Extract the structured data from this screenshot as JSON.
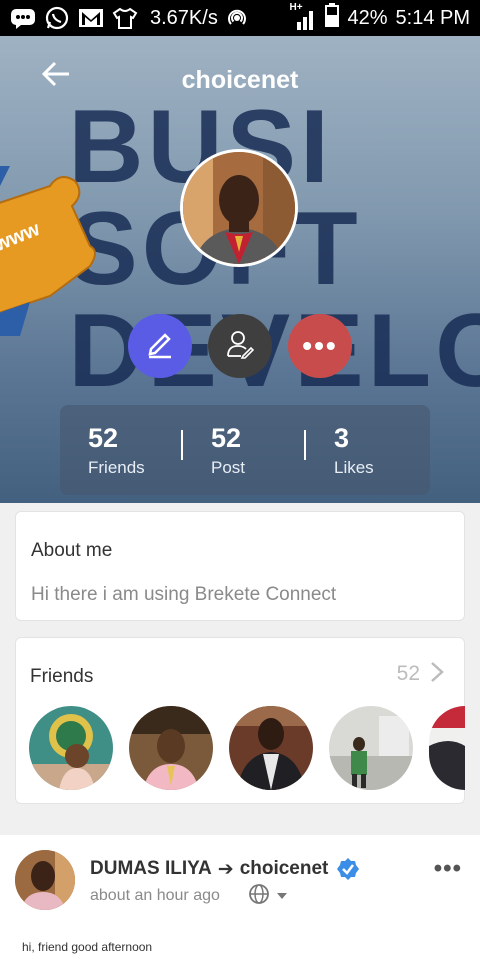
{
  "status_bar": {
    "speed": "3.67K/s",
    "network_label": "H+",
    "battery": "42%",
    "time": "5:14 PM",
    "icons": [
      "chat-icon",
      "whatsapp-icon",
      "gmail-icon",
      "shirt-icon",
      "hotspot-icon",
      "signal-icon",
      "battery-icon"
    ]
  },
  "header": {
    "title": "choicenet",
    "back_icon": "back-arrow-icon",
    "cover_text": [
      "BUSI",
      "SOFT",
      "DEVELO"
    ],
    "cover_puzzle_text": "www"
  },
  "actions": [
    {
      "name": "edit",
      "icon": "pen-icon",
      "color": "#5b5ce6"
    },
    {
      "name": "edit-profile",
      "icon": "person-edit-icon",
      "color": "#3f3f3f"
    },
    {
      "name": "more",
      "icon": "more-dots-icon",
      "label": "•••",
      "color": "#c94c4c"
    }
  ],
  "stats": [
    {
      "value": "52",
      "label": "Friends"
    },
    {
      "value": "52",
      "label": "Post"
    },
    {
      "value": "3",
      "label": "Likes"
    }
  ],
  "about": {
    "title": "About me",
    "text": "Hi there i am using Brekete Connect"
  },
  "friends": {
    "title": "Friends",
    "count": "52"
  },
  "post": {
    "author": "DUMAS ILIYA",
    "arrow": "➔",
    "target": "choicenet",
    "time": "about an hour ago",
    "more": "•••",
    "text": "hi, friend good afternoon"
  }
}
